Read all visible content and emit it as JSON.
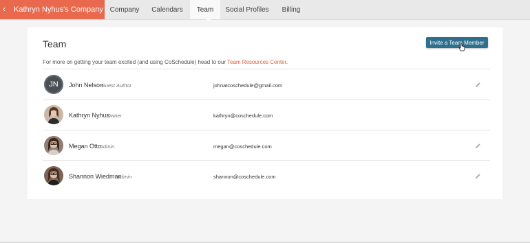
{
  "app": {
    "company_name": "Kathryn Nyhus's Company",
    "back_icon": "chevron-left-icon"
  },
  "tabs": [
    {
      "label": "Company",
      "active": false
    },
    {
      "label": "Calendars",
      "active": false
    },
    {
      "label": "Team",
      "active": true
    },
    {
      "label": "Social Profiles",
      "active": false
    },
    {
      "label": "Billing",
      "active": false
    }
  ],
  "page": {
    "title": "Team",
    "invite_label": "Invite a Team Member",
    "subtext_prefix": "For more on getting your team excited (and using CoSchedule) head to our ",
    "subtext_link": "Team Resources Center",
    "subtext_suffix": "."
  },
  "members": [
    {
      "initials": "JN",
      "name": "John Nelson",
      "role": "Guest Author",
      "email": "johnatcoschedule@gmail.com",
      "editable": true
    },
    {
      "initials": "",
      "name": "Kathryn Nyhus",
      "role": "Owner",
      "email": "kathryn@coschedule.com",
      "editable": false
    },
    {
      "initials": "",
      "name": "Megan Otto",
      "role": "Admin",
      "email": "megan@coschedule.com",
      "editable": true
    },
    {
      "initials": "",
      "name": "Shannon Wiedman",
      "role": "Admin",
      "email": "shannon@coschedule.com",
      "editable": true
    }
  ],
  "colors": {
    "brand": "#e8694d",
    "button": "#2e6f8e",
    "link": "#d4643d"
  }
}
